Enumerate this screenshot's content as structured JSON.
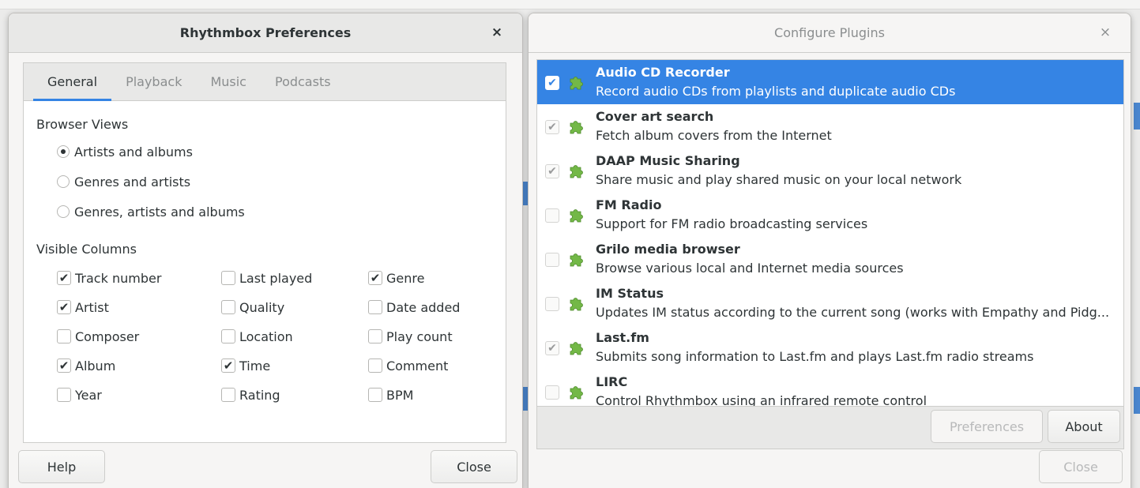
{
  "prefs": {
    "title": "Rhythmbox Preferences",
    "close_glyph": "×",
    "tabs": [
      {
        "label": "General",
        "active": true
      },
      {
        "label": "Playback",
        "active": false
      },
      {
        "label": "Music",
        "active": false
      },
      {
        "label": "Podcasts",
        "active": false
      }
    ],
    "browser_views": {
      "title": "Browser Views",
      "options": [
        {
          "label": "Artists and albums",
          "selected": true
        },
        {
          "label": "Genres and artists",
          "selected": false
        },
        {
          "label": "Genres, artists and albums",
          "selected": false
        }
      ]
    },
    "visible_columns": {
      "title": "Visible Columns",
      "items": [
        {
          "label": "Track number",
          "checked": true
        },
        {
          "label": "Artist",
          "checked": true
        },
        {
          "label": "Composer",
          "checked": false
        },
        {
          "label": "Album",
          "checked": true
        },
        {
          "label": "Year",
          "checked": false
        },
        {
          "label": "Last played",
          "checked": false
        },
        {
          "label": "Quality",
          "checked": false
        },
        {
          "label": "Location",
          "checked": false
        },
        {
          "label": "Time",
          "checked": true
        },
        {
          "label": "Rating",
          "checked": false
        },
        {
          "label": "Genre",
          "checked": true
        },
        {
          "label": "Date added",
          "checked": false
        },
        {
          "label": "Play count",
          "checked": false
        },
        {
          "label": "Comment",
          "checked": false
        },
        {
          "label": "BPM",
          "checked": false
        }
      ]
    },
    "help_label": "Help",
    "close_label": "Close"
  },
  "plugins": {
    "title": "Configure Plugins",
    "close_glyph": "×",
    "items": [
      {
        "name": "Audio CD Recorder",
        "desc": "Record audio CDs from playlists and duplicate audio CDs",
        "checked": true,
        "selected": true
      },
      {
        "name": "Cover art search",
        "desc": "Fetch album covers from the Internet",
        "checked": true,
        "selected": false
      },
      {
        "name": "DAAP Music Sharing",
        "desc": "Share music and play shared music on your local network",
        "checked": true,
        "selected": false
      },
      {
        "name": "FM Radio",
        "desc": "Support for FM radio broadcasting services",
        "checked": false,
        "selected": false
      },
      {
        "name": "Grilo media browser",
        "desc": "Browse various local and Internet media sources",
        "checked": false,
        "selected": false
      },
      {
        "name": "IM Status",
        "desc": "Updates IM status according to the current song (works with Empathy and Pidg...",
        "checked": false,
        "selected": false
      },
      {
        "name": "Last.fm",
        "desc": "Submits song information to Last.fm and plays Last.fm radio streams",
        "checked": true,
        "selected": false
      },
      {
        "name": "LIRC",
        "desc": "Control Rhythmbox using an infrared remote control",
        "checked": false,
        "selected": false
      }
    ],
    "icon": "puzzle-plugin-icon",
    "preferences_label": "Preferences",
    "about_label": "About",
    "close_label": "Close"
  },
  "colors": {
    "accent": "#3584e4",
    "plugin_icon": "#73b847"
  }
}
